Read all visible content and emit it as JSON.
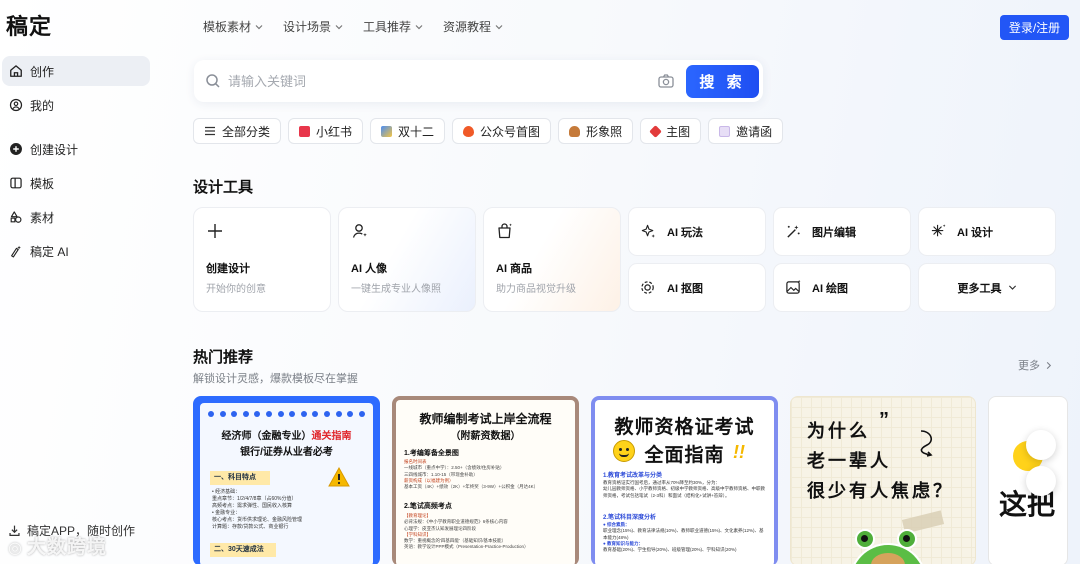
{
  "sidebar": {
    "logo": "稿定",
    "items": [
      {
        "label": "创作"
      },
      {
        "label": "我的"
      },
      {
        "label": "创建设计"
      },
      {
        "label": "模板"
      },
      {
        "label": "素材"
      },
      {
        "label": "稿定 AI"
      }
    ],
    "footer": "稿定APP，随时创作",
    "watermark": "大数跨境"
  },
  "topnav": {
    "items": [
      {
        "label": "模板素材"
      },
      {
        "label": "设计场景"
      },
      {
        "label": "工具推荐"
      },
      {
        "label": "资源教程"
      }
    ],
    "login_label": "登录/注册"
  },
  "search": {
    "placeholder": "请输入关键词",
    "button_label": "搜 索"
  },
  "chips": [
    {
      "label": "全部分类",
      "icon": "menu-icon"
    },
    {
      "label": "小红书",
      "icon": "xiaohongshu-icon",
      "color": "#e8364b"
    },
    {
      "label": "双十二",
      "icon": "shopping-bag-icon",
      "color": "#4a8df5"
    },
    {
      "label": "公众号首图",
      "icon": "flame-icon",
      "color": "#f05a28"
    },
    {
      "label": "形象照",
      "icon": "person-icon",
      "color": "#c57a3a"
    },
    {
      "label": "主图",
      "icon": "pin-icon",
      "color": "#e23b3b"
    },
    {
      "label": "邀请函",
      "icon": "envelope-icon",
      "color": "#c9b8e8"
    }
  ],
  "tools": {
    "title": "设计工具",
    "big": [
      {
        "name": "创建设计",
        "desc": "开始你的创意"
      },
      {
        "name": "AI 人像",
        "desc": "一键生成专业人像照"
      },
      {
        "name": "AI 商品",
        "desc": "助力商品视觉升级"
      }
    ],
    "small": [
      {
        "name": "AI 玩法"
      },
      {
        "name": "图片编辑"
      },
      {
        "name": "AI 设计"
      },
      {
        "name": "AI 抠图"
      },
      {
        "name": "AI 绘图"
      },
      {
        "name": "更多工具"
      }
    ]
  },
  "hot": {
    "title": "热门推荐",
    "subtitle": "解锁设计灵感，爆款模板尽在掌握",
    "more_label": "更多",
    "cards": [
      {
        "title_a": "经济师（金融专业）",
        "title_b": "通关指南",
        "subtitle": "银行/证券从业者必考",
        "sec1": "一、科目特点",
        "lines1": [
          "• 经济基础：",
          "   重点章节：1/2/4/7/8章（占60%分值）",
          "   高频考点：需求弹性、国民收入核算",
          "• 金融专业：",
          "   核心考点：货币供求理论、金融风险管理",
          "   计算题：存款/贷款公式、商业银行"
        ],
        "sec2": "二、30天速成法"
      },
      {
        "title": "教师编制考试上岸全流程",
        "subtitle": "（附薪资数据）",
        "sec1": "1.考编筹备全景图",
        "lines1": [
          "报名时间表",
          "一线城市（重点中学）：2.50+（含绩效/住房补贴）",
          "三四线城市：1.10-15（带现金补助）",
          "薪资构成（以福建为例）",
          "基本工资（4K）+绩效（2K）+年终奖（3-9W）+公积金（月达4K）"
        ],
        "sec2": "2.笔试高频考点",
        "lines2": [
          "【教育理论】",
          "必背法规：《中小学教育职业道德规范》6条核心内容",
          "心理学：皮亚杰认知发展理论四阶段",
          "【学科知识】",
          "数学：重视概念的'四基四能'（基础知识/基本技能）",
          "英语：教学设计PPP模式（Presentation-Practice-Production）"
        ]
      },
      {
        "title_a": "教师资格证考试",
        "title_b": "全面指南",
        "sec1": "1.教育考试改革与分类",
        "lines1": [
          "教育资格证实行国考后，通过率从70%降至约30%，分为：",
          "幼儿园教师资格、小学教师资格、初级中学教师资格、高级中学教师资格、中职教师资格，考试包括笔试（2-3科）和面试（结构化+试讲+答辩）。"
        ],
        "sec2": "2.笔试科目深度分析",
        "lines2": [
          "● 综合素质：",
          "职业理念(15%)、教育法律法规(10%)、教师职业道德(15%)、文化素养(12%)、基本能力(48%)",
          "● 教育知识与能力：",
          "教育基础(20%)、学生指导(20%)、班级管理(20%)、学科知识(20%)"
        ]
      },
      {
        "lines": [
          "为什么",
          "老一辈人",
          "很少有人焦虑？"
        ]
      },
      {
        "text": "这把"
      }
    ]
  }
}
